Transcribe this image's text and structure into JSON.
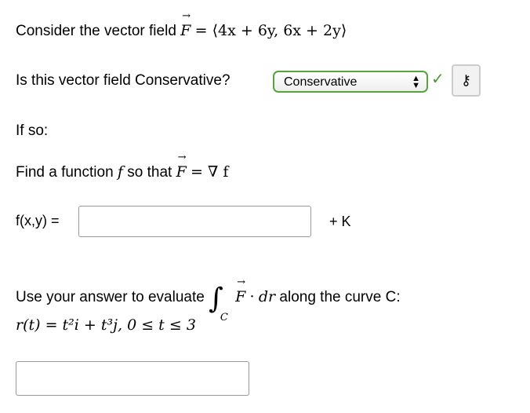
{
  "q1": {
    "text": "Consider the vector field",
    "F": "F",
    "eq": "= ⟨4x + 6y, 6x + 2y⟩"
  },
  "q2": {
    "text": "Is this vector field Conservative?",
    "selected": "Conservative",
    "status": "correct",
    "key_icon": "key-icon"
  },
  "q3": {
    "text": "If so:"
  },
  "q4": {
    "text": "Find a function",
    "f": "f",
    "mid": "so that",
    "F": "F",
    "eq": "= ∇ f"
  },
  "q5": {
    "label": "f(x,y) =",
    "value": "",
    "suffix": "+ K"
  },
  "q6": {
    "text": "Use your answer to evaluate",
    "integral": "∫",
    "sub": "C",
    "F": "F",
    "dot": "·",
    "dr": "dr",
    "rest": "along the curve C:"
  },
  "q7": {
    "curve": "r(t) = t²i + t³j,  0 ≤ t ≤ 3",
    "value": ""
  },
  "colors": {
    "correct": "#5aa33c"
  }
}
